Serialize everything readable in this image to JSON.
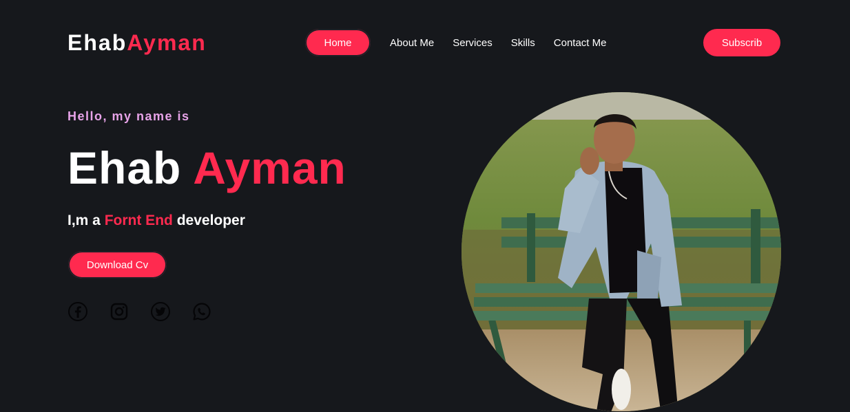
{
  "header": {
    "logo": {
      "first": "Ehab",
      "second": "Ayman"
    },
    "nav": {
      "items": [
        {
          "label": "Home",
          "active": true
        },
        {
          "label": "About Me"
        },
        {
          "label": "Services"
        },
        {
          "label": "Skills"
        },
        {
          "label": "Contact Me"
        }
      ]
    },
    "subscribe_label": "Subscrib"
  },
  "hero": {
    "greeting": "Hello, my name is",
    "name": {
      "first": "Ehab",
      "second": "Ayman"
    },
    "role": {
      "prefix": "I,m a",
      "accent": "Fornt End",
      "suffix": "developer"
    },
    "download_label": "Download Cv",
    "socials": [
      {
        "icon": "facebook-icon"
      },
      {
        "icon": "instagram-icon"
      },
      {
        "icon": "twitter-icon"
      },
      {
        "icon": "whatsapp-icon"
      }
    ]
  },
  "colors": {
    "background": "#16181c",
    "accent": "#ff2a4f",
    "greeting": "#e7a3e8",
    "text": "#ffffff"
  }
}
